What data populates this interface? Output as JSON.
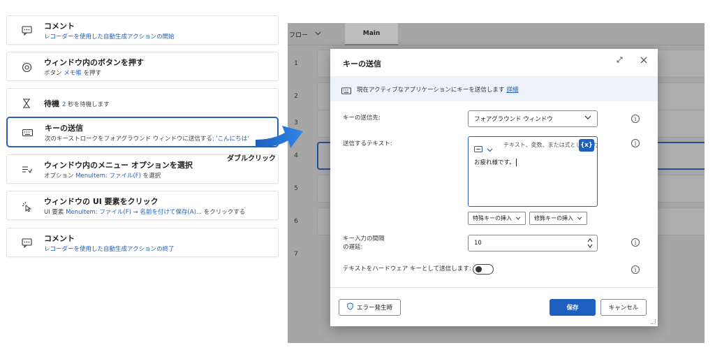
{
  "actions": [
    {
      "title": "コメント",
      "subtitle": "レコーダーを使用した自動生成アクションの開始",
      "icon": "comment-icon"
    },
    {
      "title": "ウィンドウ内のボタンを押す",
      "sub_prefix": "ボタン",
      "sub_highlight": "メモ帳",
      "sub_suffix": "を押す",
      "icon": "press-button-icon"
    },
    {
      "title": "待機",
      "sub_highlight": "2",
      "sub_suffix": "秒を待機します",
      "icon": "hourglass-icon"
    },
    {
      "title": "キーの送信",
      "sub_prefix": "次のキーストロークをフォアグラウンド ウィンドウに送信する:",
      "sub_highlight": "'こんにちは'",
      "icon": "keyboard-icon"
    },
    {
      "title": "ウィンドウ内のメニュー オプションを選択",
      "sub_prefix": "オプション",
      "sub_highlight": "MenuItem: ファイル(F)",
      "sub_suffix": "を選択",
      "icon": "menu-select-icon"
    },
    {
      "title": "ウィンドウの UI 要素をクリック",
      "sub_prefix": "UI 要素",
      "sub_highlight": "MenuItem: ファイル(F) → 名前を付けて保存(A)...",
      "sub_suffix": "をクリックする",
      "icon": "click-icon"
    },
    {
      "title": "コメント",
      "subtitle": "レコーダーを使用した自動生成アクションの終了",
      "icon": "comment-icon"
    }
  ],
  "annotation": "ダブルクリック",
  "designer": {
    "flow_tab": "フロー",
    "main_tab": "Main",
    "row_numbers": [
      "1",
      "2",
      "3",
      "4",
      "5",
      "6",
      "7"
    ]
  },
  "dialog": {
    "title": "キーの送信",
    "info_text": "現在アクティブなアプリケーションにキーを送信します",
    "info_link": "詳細",
    "target_label": "キーの送信先:",
    "target_value": "フォアグラウンド ウィンドウ",
    "text_label": "送信するテキスト:",
    "text_placeholder": "テキスト、変数、または式として入力",
    "variable_button": "{x}",
    "text_value": "お疲れ様です。",
    "special_keys_button": "特殊キーの挿入",
    "modifier_keys_button": "修飾キーの挿入",
    "delay_label_1": "キー入力の間隔",
    "delay_label_2": "の遅延:",
    "delay_value": "10",
    "hardware_label": "テキストをハードウェア キーとして送信します:",
    "hardware_toggle_on": false,
    "error_button": "エラー発生時",
    "save_button": "保存",
    "cancel_button": "キャンセル"
  },
  "colors": {
    "accent": "#1f5fbf",
    "selected_border": "#2a60b8",
    "overlay": "#a6a6a6"
  }
}
